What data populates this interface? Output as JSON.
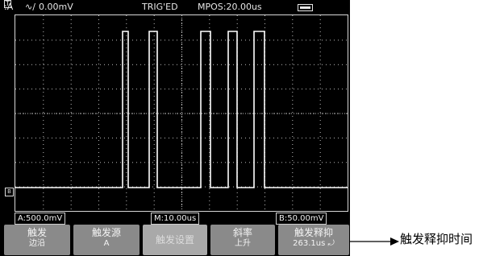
{
  "topbar": {
    "trig_channel_box": "T",
    "trig_channel": ":A",
    "edge_icon": "∿∕",
    "trig_level": "0.00mV",
    "trig_status": "TRIG'ED",
    "position": "MPOS:20.00us",
    "battery_icon": "battery-icon"
  },
  "markers": {
    "trigger_pos": "▼",
    "channel": "B",
    "level": "◄"
  },
  "readouts": {
    "cha_scale": "A:500.0mV",
    "timebase": "M:10.00us",
    "chb_scale": "B:50.00mV"
  },
  "menu": {
    "items": [
      {
        "line1": "触发",
        "line2": "边沿"
      },
      {
        "line1": "触发源",
        "line2": "A"
      },
      {
        "line1": "触发设置",
        "line2": ""
      },
      {
        "line1": "斜率",
        "line2": "上升"
      },
      {
        "line1": "触发释抑",
        "line2": "263.1us ⤾"
      }
    ]
  },
  "annotation": {
    "text": "触发释抑时间"
  },
  "colors": {
    "screen_bg": "#000000",
    "trace": "#ffffff",
    "softkey": "#8a8a8a",
    "softkey_selected": "#a9a9a9"
  }
}
